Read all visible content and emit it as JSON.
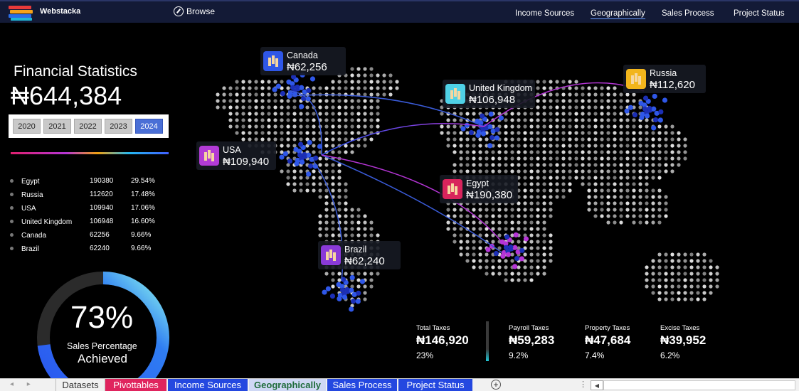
{
  "brand": {
    "name": "Webstacka"
  },
  "browse": {
    "label": "Browse",
    "icon": "compass-icon"
  },
  "nav": [
    {
      "label": "Income Sources",
      "active": false
    },
    {
      "label": "Geographically",
      "active": true
    },
    {
      "label": "Sales Process",
      "active": false
    },
    {
      "label": "Project Status",
      "active": false
    }
  ],
  "summary": {
    "title": "Financial Statistics",
    "total": "₦644,384"
  },
  "years": [
    {
      "label": "2020",
      "selected": false
    },
    {
      "label": "2021",
      "selected": false
    },
    {
      "label": "2022",
      "selected": false
    },
    {
      "label": "2023",
      "selected": false
    },
    {
      "label": "2024",
      "selected": true
    }
  ],
  "stats": [
    {
      "country": "Egypt",
      "value": "190380",
      "pct": "29.54%"
    },
    {
      "country": "Russia",
      "value": "112620",
      "pct": "17.48%"
    },
    {
      "country": "USA",
      "value": "109940",
      "pct": "17.06%"
    },
    {
      "country": "United Kingdom",
      "value": "106948",
      "pct": "16.60%"
    },
    {
      "country": "Canada",
      "value": "62256",
      "pct": "9.66%"
    },
    {
      "country": "Brazil",
      "value": "62240",
      "pct": "9.66%"
    }
  ],
  "gauge": {
    "percent": "73%",
    "fraction": 0.73,
    "label_line1": "Sales Percentage",
    "label_line2": "Achieved"
  },
  "callouts": {
    "canada": {
      "name": "Canada",
      "amount": "₦62,256",
      "icon_color": "#2f57e8"
    },
    "uk": {
      "name": "United Kingdom",
      "amount": "₦106,948",
      "icon_color": "#4fd1e6"
    },
    "russia": {
      "name": "Russia",
      "amount": "₦112,620",
      "icon_color": "#f2b51c"
    },
    "usa": {
      "name": "USA",
      "amount": "₦109,940",
      "icon_color": "#b23bd6"
    },
    "egypt": {
      "name": "Egypt",
      "amount": "₦190,380",
      "icon_color": "#d8245c"
    },
    "brazil": {
      "name": "Brazil",
      "amount": "₦62,240",
      "icon_color": "#8a3ad8"
    }
  },
  "taxes": [
    {
      "label": "Total Taxes",
      "amount": "₦146,920",
      "pct": "23%"
    },
    {
      "label": "Payroll Taxes",
      "amount": "₦59,283",
      "pct": "9.2%"
    },
    {
      "label": "Property Taxes",
      "amount": "₦47,684",
      "pct": "7.4%"
    },
    {
      "label": "Excise Taxes",
      "amount": "₦39,952",
      "pct": "6.2%"
    }
  ],
  "sheet_tabs": [
    {
      "label": "Datasets",
      "color": "#f1f1f1",
      "text": "#333"
    },
    {
      "label": "Pivottables",
      "color": "#e0245e",
      "text": "#ffffff"
    },
    {
      "label": "Income Sources",
      "color": "#2448e0",
      "text": "#ffffff"
    },
    {
      "label": "Geographically",
      "color": "#cfd8f5",
      "text": "#1e6b3a"
    },
    {
      "label": "Sales Process",
      "color": "#2448e0",
      "text": "#ffffff"
    },
    {
      "label": "Project Status",
      "color": "#2448e0",
      "text": "#ffffff"
    }
  ],
  "colors": {
    "topbar": "#131a36",
    "accent_blue": "#2f57e8",
    "accent_cyan": "#7ef0f0",
    "accent_purple": "#b535d6"
  }
}
